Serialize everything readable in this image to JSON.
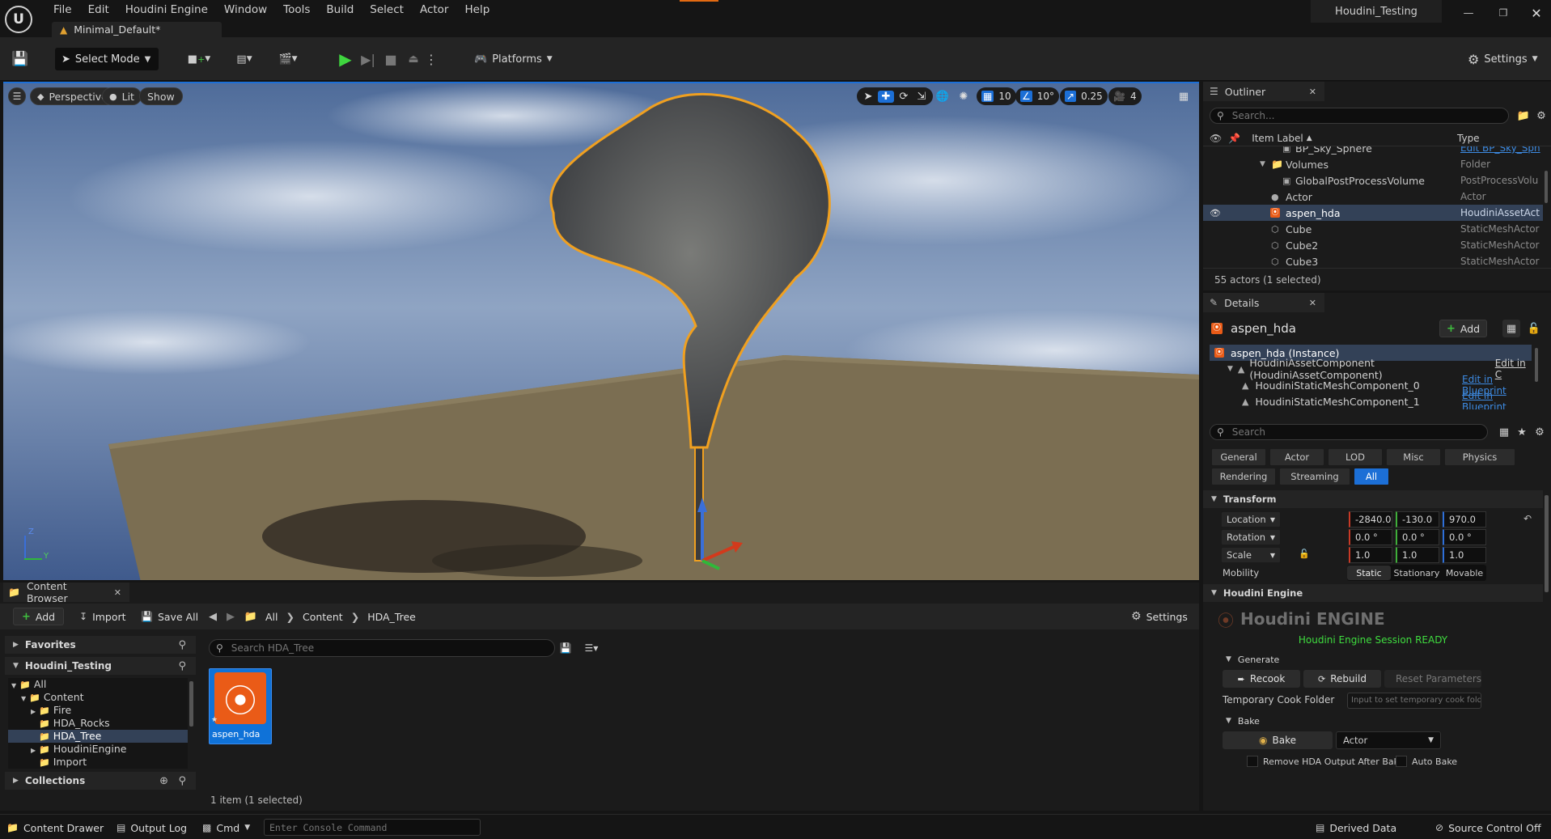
{
  "menubar": {
    "items": [
      "File",
      "Edit",
      "Houdini Engine",
      "Window",
      "Tools",
      "Build",
      "Select",
      "Actor",
      "Help"
    ],
    "project_name": "Houdini_Testing"
  },
  "tab": {
    "label": "Minimal_Default*"
  },
  "toolbar": {
    "select_mode": "Select Mode",
    "platforms": "Platforms",
    "settings": "Settings"
  },
  "viewport": {
    "perspective": "Perspective",
    "lit": "Lit",
    "show": "Show",
    "grid_snap": "10",
    "rot_snap": "10°",
    "scale_snap": "0.25",
    "cam_speed": "4",
    "axis_z": "Z",
    "axis_y": "Y"
  },
  "outliner": {
    "tab": "Outliner",
    "search_placeholder": "Search...",
    "col_label": "Item Label",
    "col_type": "Type",
    "rows": [
      {
        "label": "BP_Sky_Sphere",
        "type": "Edit BP_Sky_Sph",
        "indent": 2,
        "selected": false
      },
      {
        "label": "Volumes",
        "type": "Folder",
        "indent": 1,
        "selected": false
      },
      {
        "label": "GlobalPostProcessVolume",
        "type": "PostProcessVolu",
        "indent": 2,
        "selected": false
      },
      {
        "label": "Actor",
        "type": "Actor",
        "indent": 1,
        "selected": false
      },
      {
        "label": "aspen_hda",
        "type": "HoudiniAssetAct",
        "indent": 1,
        "selected": true
      },
      {
        "label": "Cube",
        "type": "StaticMeshActor",
        "indent": 1,
        "selected": false
      },
      {
        "label": "Cube2",
        "type": "StaticMeshActor",
        "indent": 1,
        "selected": false
      },
      {
        "label": "Cube3",
        "type": "StaticMeshActor",
        "indent": 1,
        "selected": false
      }
    ],
    "status": "55 actors (1 selected)"
  },
  "details": {
    "tab": "Details",
    "actor_name": "aspen_hda",
    "add_label": "Add",
    "components": {
      "instance": "aspen_hda (Instance)",
      "asset_component": "HoudiniAssetComponent (HoudiniAssetComponent)",
      "asset_component_link": "Edit in C",
      "mesh0": "HoudiniStaticMeshComponent_0",
      "mesh1": "HoudiniStaticMeshComponent_1",
      "edit_bp": "Edit in Blueprint"
    },
    "search_placeholder": "Search",
    "categories_row1": [
      "General",
      "Actor",
      "LOD",
      "Misc",
      "Physics"
    ],
    "categories_row2": [
      "Rendering",
      "Streaming",
      "All"
    ],
    "active_category": "All",
    "transform": {
      "header": "Transform",
      "location_label": "Location",
      "rotation_label": "Rotation",
      "scale_label": "Scale",
      "location": [
        "-2840.0",
        "-130.0",
        "970.0"
      ],
      "rotation": [
        "0.0 °",
        "0.0 °",
        "0.0 °"
      ],
      "scale": [
        "1.0",
        "1.0",
        "1.0"
      ],
      "mobility_label": "Mobility",
      "mobility_options": [
        "Static",
        "Stationary",
        "Movable"
      ],
      "mobility_selected": "Static"
    },
    "houdini": {
      "header": "Houdini Engine",
      "logo_text": "Houdini ENGINE",
      "session_status": "Houdini Engine Session READY",
      "generate_header": "Generate",
      "recook": "Recook",
      "rebuild": "Rebuild",
      "reset": "Reset Parameters",
      "temp_folder_label": "Temporary Cook Folder",
      "temp_folder_placeholder": "Input to set temporary cook folder",
      "bake_header": "Bake",
      "bake": "Bake",
      "bake_target": "Actor",
      "remove_output": "Remove HDA Output After Bake",
      "auto_bake": "Auto Bake"
    }
  },
  "content_browser": {
    "tab": "Content Browser",
    "add": "Add",
    "import": "Import",
    "save_all": "Save All",
    "breadcrumb": [
      "All",
      "Content",
      "HDA_Tree"
    ],
    "settings": "Settings",
    "favorites": "Favorites",
    "project": "Houdini_Testing",
    "tree": [
      {
        "label": "All",
        "indent": 0,
        "expanded": true,
        "selected": false
      },
      {
        "label": "Content",
        "indent": 1,
        "expanded": true,
        "selected": false
      },
      {
        "label": "Fire",
        "indent": 2,
        "expanded": false,
        "selected": false
      },
      {
        "label": "HDA_Rocks",
        "indent": 2,
        "expanded": false,
        "selected": false
      },
      {
        "label": "HDA_Tree",
        "indent": 2,
        "expanded": false,
        "selected": true
      },
      {
        "label": "HoudiniEngine",
        "indent": 2,
        "expanded": false,
        "selected": false
      },
      {
        "label": "Import",
        "indent": 2,
        "expanded": false,
        "selected": false
      }
    ],
    "collections": "Collections",
    "search_placeholder": "Search HDA_Tree",
    "asset_name": "aspen_hda",
    "item_count": "1 item (1 selected)"
  },
  "statusbar": {
    "content_drawer": "Content Drawer",
    "output_log": "Output Log",
    "cmd": "Cmd",
    "console_placeholder": "Enter Console Command",
    "derived_data": "Derived Data",
    "source_control": "Source Control Off"
  }
}
